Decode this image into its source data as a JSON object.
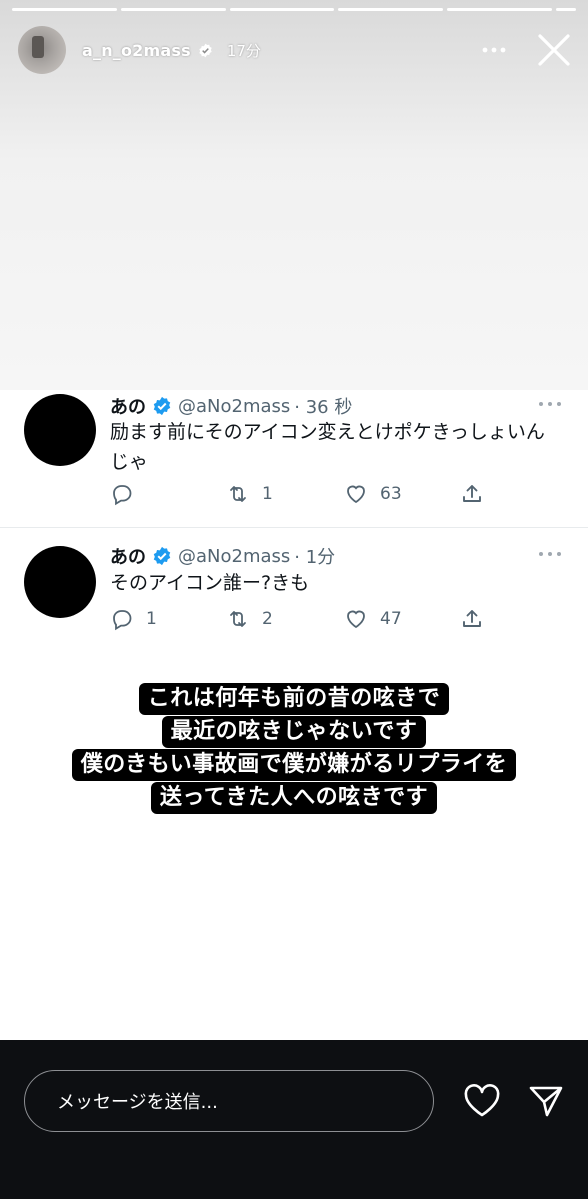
{
  "story": {
    "username": "a_n_o2mass",
    "time_ago": "17分"
  },
  "tweets": [
    {
      "display_name": "あの",
      "handle": "@aNo2mass",
      "time": "· 36 秒",
      "text_line1": "励ます前にそのアイコン変えとけポケきっしょいん",
      "text_line2": "じゃ",
      "replies": "",
      "retweets": "1",
      "likes": "63"
    },
    {
      "display_name": "あの",
      "handle": "@aNo2mass",
      "time": "· 1分",
      "text_line1": "そのアイコン誰ー?きも",
      "text_line2": "",
      "replies": "1",
      "retweets": "2",
      "likes": "47"
    }
  ],
  "caption": {
    "lines": [
      "これは何年も前の昔の呟きで",
      "最近の呟きじゃないです",
      "僕のきもい事故画で僕が嫌がるリプライを",
      "送ってきた人への呟きです"
    ]
  },
  "reply_bar": {
    "placeholder": "メッセージを送信..."
  },
  "icons": {
    "more": "more-horizontal-icon",
    "close": "close-icon",
    "verified": "verified-badge-icon",
    "reply": "reply-icon",
    "retweet": "retweet-icon",
    "like": "heart-icon",
    "share": "share-icon",
    "send": "send-icon"
  },
  "colors": {
    "verified_blue": "#1d9bf0",
    "tweet_text": "#0f1419",
    "tweet_meta": "#536471",
    "bottom_bar": "#0d0f12"
  }
}
